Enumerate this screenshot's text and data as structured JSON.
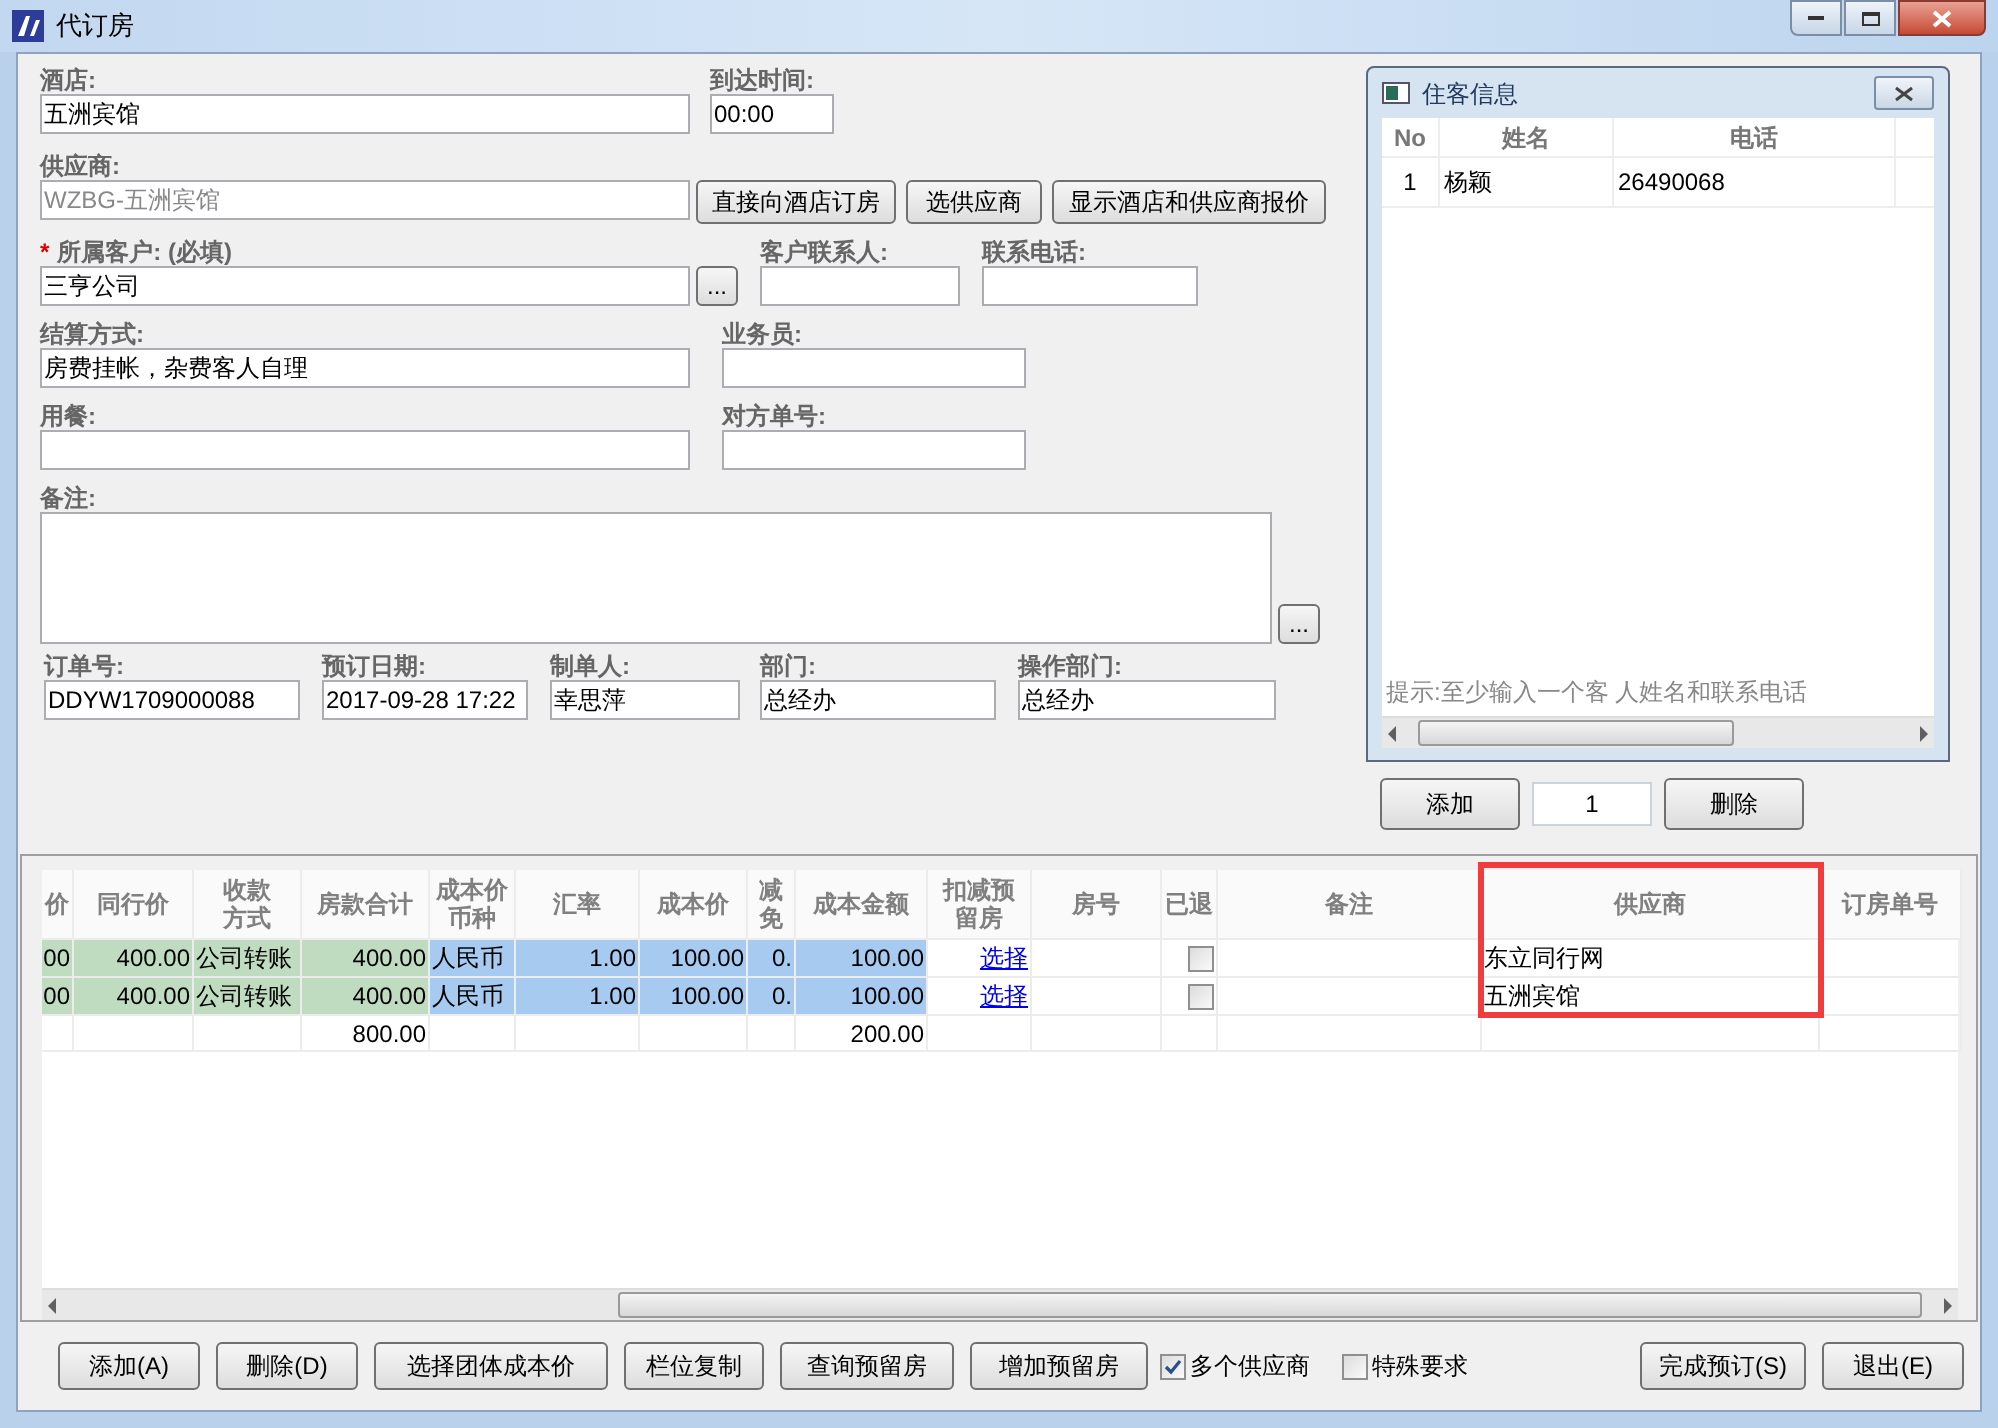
{
  "window": {
    "title": "代订房"
  },
  "form": {
    "fields": [
      {
        "label": "酒店:",
        "value": "五洲宾馆"
      },
      {
        "label": "到达时间:",
        "value": "00:00"
      },
      {
        "label": "供应商:",
        "value": "WZBG-五洲宾馆",
        "disabled": true
      },
      {
        "label": "所属客户: (必填)",
        "value": "三亨公司",
        "required_mark": "*",
        "picker_button": "..."
      },
      {
        "label": "客户联系人:"
      },
      {
        "label": "联系电话:"
      },
      {
        "label": "结算方式:",
        "value": "房费挂帐，杂费客人自理"
      },
      {
        "label": "业务员:"
      },
      {
        "label": "用餐:"
      },
      {
        "label": "对方单号:"
      },
      {
        "label": "备注:",
        "picker_button": "..."
      },
      {
        "label": "订单号:",
        "value": "DDYW1709000088"
      },
      {
        "label": "预订日期:",
        "value": "2017-09-28 17:22"
      },
      {
        "label": "制单人:",
        "value": "幸思萍"
      },
      {
        "label": "部门:",
        "value": "总经办"
      },
      {
        "label": "操作部门:",
        "value": "总经办"
      }
    ],
    "supplier_buttons": [
      "直接向酒店订房",
      "选供应商",
      "显示酒店和供应商报价"
    ]
  },
  "guest_panel": {
    "title": "住客信息",
    "columns": [
      "No",
      "姓名",
      "电话"
    ],
    "rows": [
      [
        "1",
        "杨颖",
        "26490068"
      ]
    ],
    "hint": "提示:至少输入一个客 人姓名和联系电话",
    "add_button": "添加",
    "count": "1",
    "delete_button": "删除"
  },
  "grid": {
    "columns": [
      {
        "label": "价",
        "kind": "sale"
      },
      {
        "label": "同行价",
        "kind": "sale"
      },
      {
        "label": "收款方式",
        "kind": "sale"
      },
      {
        "label": "房款合计",
        "kind": "sale"
      },
      {
        "label": "成本价币种",
        "kind": "cost"
      },
      {
        "label": "汇率",
        "kind": "cost"
      },
      {
        "label": "成本价",
        "kind": "cost"
      },
      {
        "label": "减免",
        "kind": "cost"
      },
      {
        "label": "成本金额",
        "kind": "cost"
      },
      {
        "label": "扣减预留房",
        "kind": "link"
      },
      {
        "label": "房号",
        "kind": "plain"
      },
      {
        "label": "已退",
        "kind": "check"
      },
      {
        "label": "备注",
        "kind": "plain"
      },
      {
        "label": "供应商",
        "kind": "plain",
        "highlighted": true
      },
      {
        "label": "订房单号",
        "kind": "plain"
      }
    ],
    "rows": [
      {
        "column_0": "00",
        "column_1": "400.00",
        "column_2": "公司转账",
        "column_3": "400.00",
        "column_4": "人民币",
        "column_5": "1.00",
        "column_6": "100.00",
        "column_7": "0.",
        "column_8": "100.00",
        "column_9": "选择",
        "column_11": false,
        "column_13": "东立同行网"
      },
      {
        "column_0": "00",
        "column_1": "400.00",
        "column_2": "公司转账",
        "column_3": "400.00",
        "column_4": "人民币",
        "column_5": "1.00",
        "column_6": "100.00",
        "column_7": "0.",
        "column_8": "100.00",
        "column_9": "选择",
        "column_11": false,
        "column_13": "五洲宾馆"
      }
    ],
    "totals": {
      "column_3": "800.00",
      "column_8": "200.00"
    }
  },
  "footer": {
    "buttons_left": [
      "添加(A)",
      "删除(D)",
      "选择团体成本价",
      "栏位复制",
      "查询预留房",
      "增加预留房"
    ],
    "checkboxes": [
      {
        "label": "多个供应商",
        "checked": true
      },
      {
        "label": "特殊要求",
        "checked": false
      }
    ],
    "buttons_right": [
      "完成预订(S)",
      "退出(E)"
    ]
  }
}
